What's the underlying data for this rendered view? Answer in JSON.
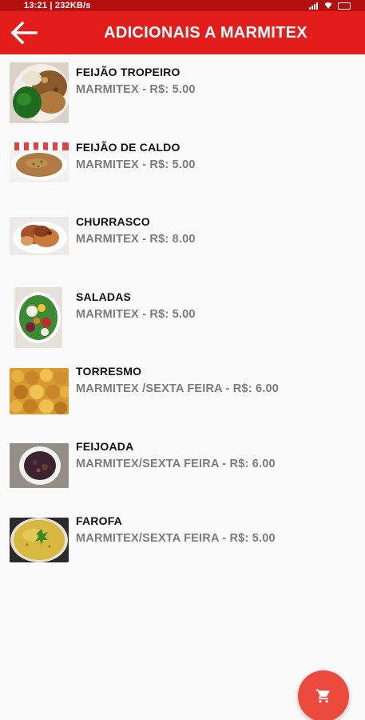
{
  "status_bar": {
    "time_text": "13:21 | 232KB/s"
  },
  "app_bar": {
    "title": "ADICIONAIS A MARMITEX",
    "back_icon": "arrow-back-icon",
    "color": "#e31c1c"
  },
  "items": [
    {
      "name": "FEIJÃO TROPEIRO",
      "subtitle": "MARMITEX  - R$: 5.00",
      "image": "feijao-tropeiro-photo"
    },
    {
      "name": "FEIJÃO  DE CALDO",
      "subtitle": "MARMITEX  - R$: 5.00",
      "image": "feijao-de-caldo-photo"
    },
    {
      "name": "CHURRASCO",
      "subtitle": "MARMITEX  - R$: 8.00",
      "image": "churrasco-photo"
    },
    {
      "name": "SALADAS",
      "subtitle": "MARMITEX  - R$: 5.00",
      "image": "saladas-photo"
    },
    {
      "name": "TORRESMO",
      "subtitle": "MARMITEX /SEXTA FEIRA  - R$: 6.00",
      "image": "torresmo-photo"
    },
    {
      "name": "FEIJOADA",
      "subtitle": "MARMITEX/SEXTA FEIRA  - R$: 6.00",
      "image": "feijoada-photo"
    },
    {
      "name": "FAROFA",
      "subtitle": "MARMITEX/SEXTA FEIRA  - R$: 5.00",
      "image": "farofa-photo"
    }
  ],
  "fab": {
    "icon": "cart-icon",
    "color": "#ec4a3c"
  }
}
